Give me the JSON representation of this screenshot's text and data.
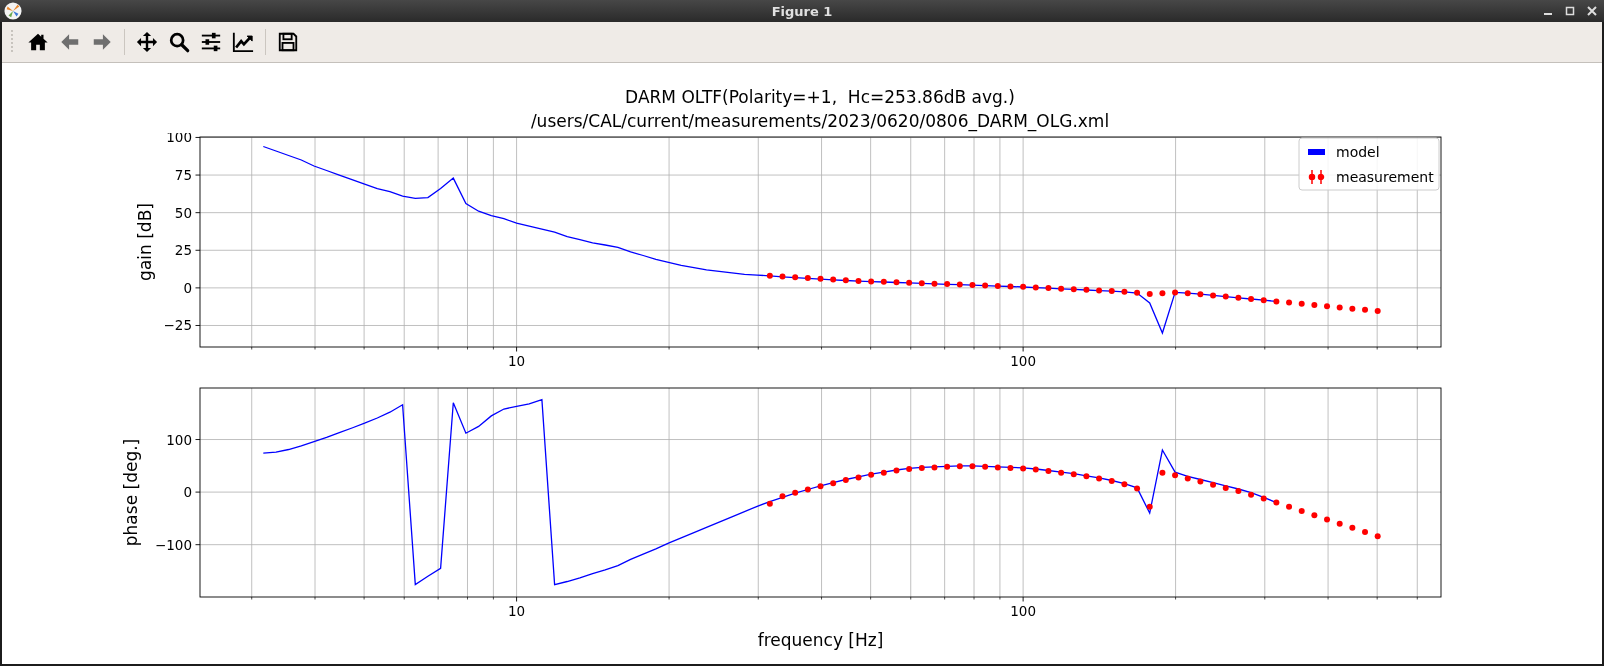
{
  "window": {
    "title": "Figure 1"
  },
  "toolbar": {
    "groups": [
      [
        {
          "kind": "home",
          "disabled": false
        },
        {
          "kind": "back",
          "disabled": true
        },
        {
          "kind": "forward",
          "disabled": true
        }
      ],
      [
        {
          "kind": "pan",
          "disabled": false
        },
        {
          "kind": "zoom",
          "disabled": false
        },
        {
          "kind": "subplots",
          "disabled": false
        },
        {
          "kind": "edit",
          "disabled": false
        }
      ],
      [
        {
          "kind": "save",
          "disabled": false
        }
      ]
    ]
  },
  "figure": {
    "title_lines": [
      "DARM OLTF(Polarity=+1,  Hc=253.86dB avg.)",
      "/users/CAL/current/measurements/2023/0620/0806_DARM_OLG.xml"
    ]
  },
  "gain_plot": {
    "chart_data": {
      "type": "line",
      "ylabel": "gain [dB]",
      "legend": "upper right",
      "grid": true,
      "ylim": [
        -39.3,
        100.3
      ],
      "yticks": [
        {
          "value": -25,
          "label": "−25"
        },
        {
          "value": 0,
          "label": "0"
        },
        {
          "value": 25,
          "label": "25"
        },
        {
          "value": 50,
          "label": "50"
        },
        {
          "value": 75,
          "label": "75"
        },
        {
          "value": 100,
          "label": "100"
        }
      ],
      "categories": [
        null,
        null,
        null,
        null,
        null,
        null,
        null,
        null,
        null,
        null,
        null,
        null,
        null,
        null,
        null,
        null,
        null,
        null,
        null,
        null,
        null,
        null,
        null,
        null,
        null,
        "10",
        null,
        null,
        null,
        null,
        null,
        null,
        null,
        null,
        null,
        null,
        null,
        null,
        null,
        null,
        null,
        null,
        null,
        null,
        null,
        null,
        null,
        null,
        null,
        null,
        null,
        null,
        null,
        null,
        null,
        null,
        null,
        null,
        null,
        null,
        null,
        null,
        null,
        null,
        null,
        "100",
        null,
        null,
        null,
        null,
        null,
        null,
        null,
        null,
        null,
        null,
        null,
        null,
        null,
        null,
        null,
        null,
        null,
        null,
        null,
        null,
        null,
        null,
        null,
        null,
        null,
        null,
        null,
        null,
        null,
        null,
        null,
        null,
        null
      ],
      "series": [
        {
          "name": "model",
          "type": "line",
          "color": "#0000ff",
          "values": [
            null,
            null,
            null,
            null,
            null,
            94,
            91,
            88,
            85,
            81,
            78,
            75,
            72,
            69,
            66,
            64,
            61,
            59.5,
            60,
            66,
            73,
            56,
            51,
            48,
            46,
            43,
            41,
            39,
            37,
            34,
            32,
            30,
            28.5,
            27,
            24,
            21.5,
            19,
            17,
            15,
            13.5,
            12,
            11,
            10,
            9,
            8.5,
            8,
            7.3,
            6.8,
            6.3,
            5.8,
            5.3,
            4.9,
            4.5,
            4.2,
            3.9,
            3.6,
            3.3,
            3.0,
            2.7,
            2.4,
            2.1,
            1.8,
            1.5,
            1.2,
            0.9,
            0.6,
            0.2,
            -0.2,
            -0.6,
            -1.0,
            -1.4,
            -1.8,
            -2.2,
            -2.7,
            -3.5,
            -10,
            -30,
            -3,
            -3.5,
            -4.2,
            -5,
            -5.8,
            -6.6,
            -7.4,
            -8.2,
            -9,
            null,
            null,
            null,
            null,
            null,
            null,
            null,
            null,
            null,
            null,
            null,
            null,
            null
          ]
        },
        {
          "name": "measurement",
          "type": "scatter",
          "color": "#ff0000",
          "values": [
            null,
            null,
            null,
            null,
            null,
            null,
            null,
            null,
            null,
            null,
            null,
            null,
            null,
            null,
            null,
            null,
            null,
            null,
            null,
            null,
            null,
            null,
            null,
            null,
            null,
            null,
            null,
            null,
            null,
            null,
            null,
            null,
            null,
            null,
            null,
            null,
            null,
            null,
            null,
            null,
            null,
            null,
            null,
            null,
            null,
            8,
            7.5,
            7,
            6.5,
            6,
            5.5,
            5,
            4.6,
            4.3,
            4.0,
            3.7,
            3.4,
            3.1,
            2.8,
            2.5,
            2.2,
            1.9,
            1.6,
            1.3,
            1.0,
            0.7,
            0.3,
            -0.1,
            -0.5,
            -0.9,
            -1.3,
            -1.7,
            -2.1,
            -2.6,
            -3.2,
            -4,
            -3.5,
            -3,
            -3.5,
            -4.2,
            -5,
            -5.8,
            -6.6,
            -7.4,
            -8.2,
            -9,
            -9.8,
            -10.6,
            -11.4,
            -12.2,
            -13,
            -13.8,
            -14.6,
            -15.4,
            null,
            null,
            null,
            null,
            null
          ]
        }
      ]
    }
  },
  "phase_plot": {
    "chart_data": {
      "type": "line",
      "ylabel": "phase [deg.]",
      "xlabel": "frequency [Hz]",
      "grid": true,
      "ylim": [
        -199.5,
        198
      ],
      "yticks": [
        {
          "value": -100,
          "label": "−100"
        },
        {
          "value": 0,
          "label": "0"
        },
        {
          "value": 100,
          "label": "100"
        }
      ],
      "categories": [
        null,
        null,
        null,
        null,
        null,
        null,
        null,
        null,
        null,
        null,
        null,
        null,
        null,
        null,
        null,
        null,
        null,
        null,
        null,
        null,
        null,
        null,
        null,
        null,
        null,
        "10",
        null,
        null,
        null,
        null,
        null,
        null,
        null,
        null,
        null,
        null,
        null,
        null,
        null,
        null,
        null,
        null,
        null,
        null,
        null,
        null,
        null,
        null,
        null,
        null,
        null,
        null,
        null,
        null,
        null,
        null,
        null,
        null,
        null,
        null,
        null,
        null,
        null,
        null,
        null,
        "100",
        null,
        null,
        null,
        null,
        null,
        null,
        null,
        null,
        null,
        null,
        null,
        null,
        null,
        null,
        null,
        null,
        null,
        null,
        null,
        null,
        null,
        null,
        null,
        null,
        null,
        null,
        null,
        null,
        null,
        null,
        null,
        null,
        null
      ],
      "series": [
        {
          "type": "line",
          "color": "#0000ff",
          "values": [
            null,
            null,
            null,
            null,
            null,
            74,
            76,
            81,
            88,
            96,
            104,
            113,
            122,
            131,
            141,
            152,
            166,
            -176,
            -160,
            -145,
            170,
            112,
            125,
            145,
            158,
            163,
            168,
            176,
            -176,
            -170,
            -163,
            -155,
            -148,
            -140,
            -128,
            -118,
            -108,
            -97,
            -87,
            -77,
            -67,
            -57,
            -47,
            -37,
            -27,
            -18,
            -10,
            -2,
            5,
            12,
            18,
            24,
            29,
            34,
            38,
            42,
            45,
            47,
            48,
            49,
            50,
            50,
            49,
            48,
            47,
            46,
            44,
            41,
            38,
            35,
            31,
            27,
            22,
            16,
            8,
            -40,
            80,
            38,
            30,
            24,
            18,
            12,
            6,
            -1,
            -10,
            -20,
            null,
            null,
            null,
            null,
            null,
            null,
            null,
            null,
            null,
            null,
            null,
            null,
            null
          ]
        },
        {
          "type": "scatter",
          "color": "#ff0000",
          "values": [
            null,
            null,
            null,
            null,
            null,
            null,
            null,
            null,
            null,
            null,
            null,
            null,
            null,
            null,
            null,
            null,
            null,
            null,
            null,
            null,
            null,
            null,
            null,
            null,
            null,
            null,
            null,
            null,
            null,
            null,
            null,
            null,
            null,
            null,
            null,
            null,
            null,
            null,
            null,
            null,
            null,
            null,
            null,
            null,
            null,
            -22,
            -8,
            -1,
            5,
            11,
            17,
            23,
            28,
            33,
            37,
            41,
            44,
            46,
            47,
            48,
            49,
            49,
            48,
            47,
            46,
            45,
            43,
            40,
            37,
            34,
            30,
            26,
            21,
            15,
            7,
            -28,
            37,
            32,
            26,
            20,
            14,
            8,
            2,
            -5,
            -12,
            -20,
            -28,
            -36,
            -44,
            -52,
            -60,
            -68,
            -76,
            -84,
            null,
            null,
            null,
            null,
            null
          ]
        }
      ]
    }
  }
}
